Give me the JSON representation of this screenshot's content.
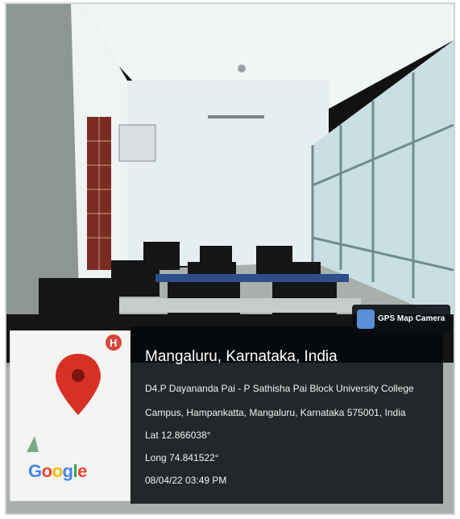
{
  "badge": {
    "label": "GPS Map Camera",
    "icon": "gps-map-camera-icon"
  },
  "location": {
    "title": "Mangaluru, Karnataka, India",
    "address_line_1": "D4.P Dayananda Pai - P Sathisha Pai Block University College",
    "address_line_2": "Campus, Hampankatta, Mangaluru, Karnataka 575001, India",
    "lat": "Lat 12.866038°",
    "long": "Long 74.841522°",
    "timestamp": "08/04/22 03:49 PM"
  },
  "map": {
    "logo_text": "Google",
    "pin_color": "#d93025",
    "marker_label": "H"
  },
  "colors": {
    "wall": "#e8f0f3",
    "glass": "#b7d4d8",
    "desk": "#1a1a1a",
    "window_frame": "#8a2f22",
    "overlay": "#070b10"
  }
}
